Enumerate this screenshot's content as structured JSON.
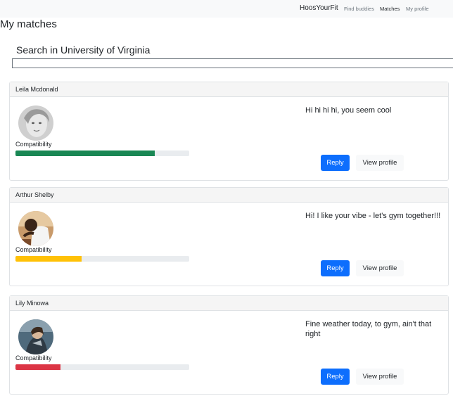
{
  "navbar": {
    "brand": "HoosYourFit",
    "links": [
      {
        "label": "Find buddies",
        "active": false
      },
      {
        "label": "Matches",
        "active": true
      },
      {
        "label": "My profile",
        "active": false
      }
    ]
  },
  "page": {
    "title": "My matches",
    "search_label": "Search in University of Virginia",
    "search_value": ""
  },
  "matches": [
    {
      "name": "Leila Mcdonald",
      "compat_label": "Compatibility",
      "compatibility_percent": 80,
      "bar_color": "#198754",
      "message": "Hi hi hi hi, you seem cool",
      "reply_label": "Reply",
      "view_label": "View profile"
    },
    {
      "name": "Arthur Shelby",
      "compat_label": "Compatibility",
      "compatibility_percent": 38,
      "bar_color": "#ffc107",
      "message": "Hi! I like your vibe - let's gym together!!!",
      "reply_label": "Reply",
      "view_label": "View profile"
    },
    {
      "name": "Lily Minowa",
      "compat_label": "Compatibility",
      "compatibility_percent": 26,
      "bar_color": "#dc3545",
      "message": "Fine weather today, to gym, ain't that right",
      "reply_label": "Reply",
      "view_label": "View profile"
    }
  ]
}
